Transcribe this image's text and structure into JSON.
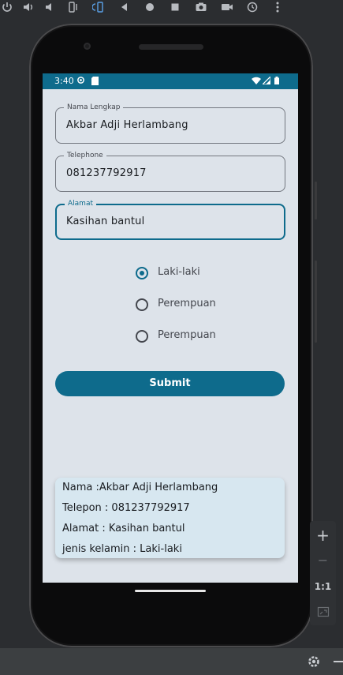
{
  "phone": {
    "status_time": "3:40"
  },
  "form": {
    "name_label": "Nama Lengkap",
    "name_value": "Akbar Adji Herlambang",
    "phone_label": "Telephone",
    "phone_value": "081237792917",
    "address_label": "Alamat",
    "address_value": "Kasihan bantul",
    "gender_options": [
      {
        "label": "Laki-laki",
        "checked": true
      },
      {
        "label": "Perempuan",
        "checked": false
      },
      {
        "label": "Perempuan",
        "checked": false
      }
    ],
    "submit_label": "Submit"
  },
  "result": {
    "line1": "Nama :Akbar Adji Herlambang",
    "line2": "Telepon : 081237792917",
    "line3": "Alamat : Kasihan bantul",
    "line4": "jenis kelamin : Laki-laki"
  },
  "emulator": {
    "zoom_in": "+",
    "zoom_out": "−",
    "ratio": "1:1"
  },
  "colors": {
    "primary": "#0e6b8c",
    "surface": "#dde3ea",
    "card": "#d7e7f0"
  }
}
